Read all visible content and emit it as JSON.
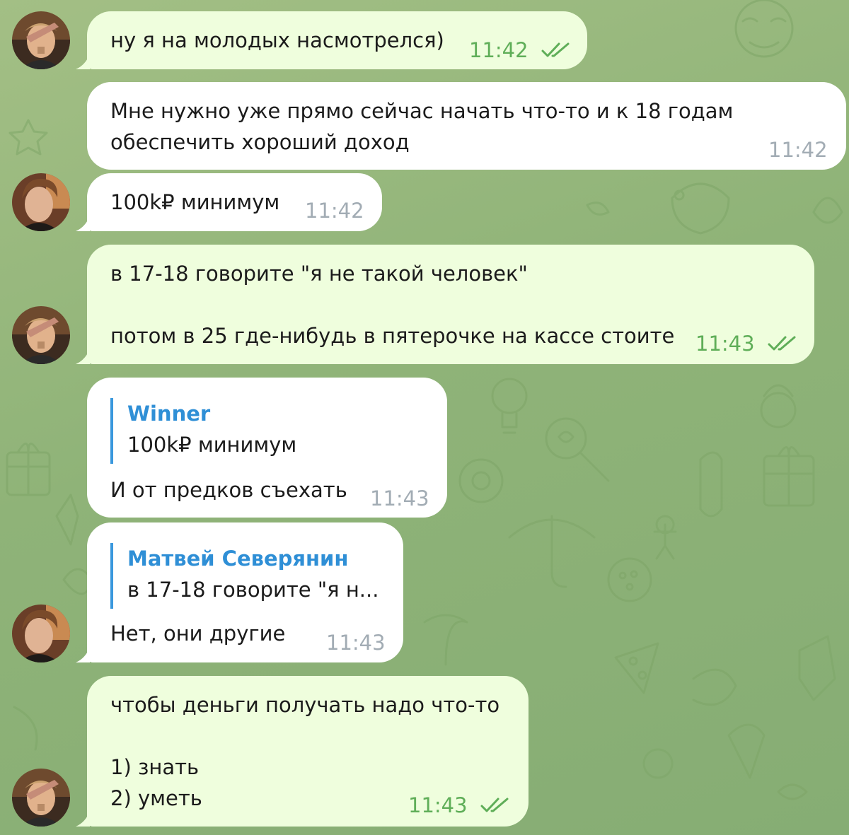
{
  "colors": {
    "outgoing_bubble": "#effedd",
    "incoming_bubble": "#ffffff",
    "outgoing_time": "#5fae58",
    "incoming_time": "#a2acb4",
    "reply_accent": "#3a98dd",
    "background": "#8fb378"
  },
  "messages": [
    {
      "direction": "outgoing",
      "text": "ну я на молодых насмотрелся)",
      "time": "11:42",
      "status": "read-double-check-icon"
    },
    {
      "direction": "incoming",
      "text": "Мне нужно уже прямо сейчас начать что-то и к 18 годам\nобеспечить хороший доход",
      "time": "11:42"
    },
    {
      "direction": "incoming",
      "text": "100k₽ минимум",
      "time": "11:42"
    },
    {
      "direction": "outgoing",
      "text": "в 17-18 говорите \"я не такой человек\"\n\nпотом в 25 где-нибудь в пятерочке на кассе стоите",
      "time": "11:43",
      "status": "read-double-check-icon"
    },
    {
      "direction": "incoming",
      "reply_name": "Winner",
      "reply_text": "100k₽ минимум",
      "text": "И от предков съехать",
      "time": "11:43"
    },
    {
      "direction": "incoming",
      "reply_name": "Матвей Северянин",
      "reply_text": "в 17-18 говорите \"я н...",
      "text": "Нет, они другие",
      "time": "11:43"
    },
    {
      "direction": "outgoing",
      "text": "чтобы деньги получать надо что-то\n\n1) знать\n2) уметь",
      "time": "11:43",
      "status": "read-double-check-icon"
    }
  ]
}
